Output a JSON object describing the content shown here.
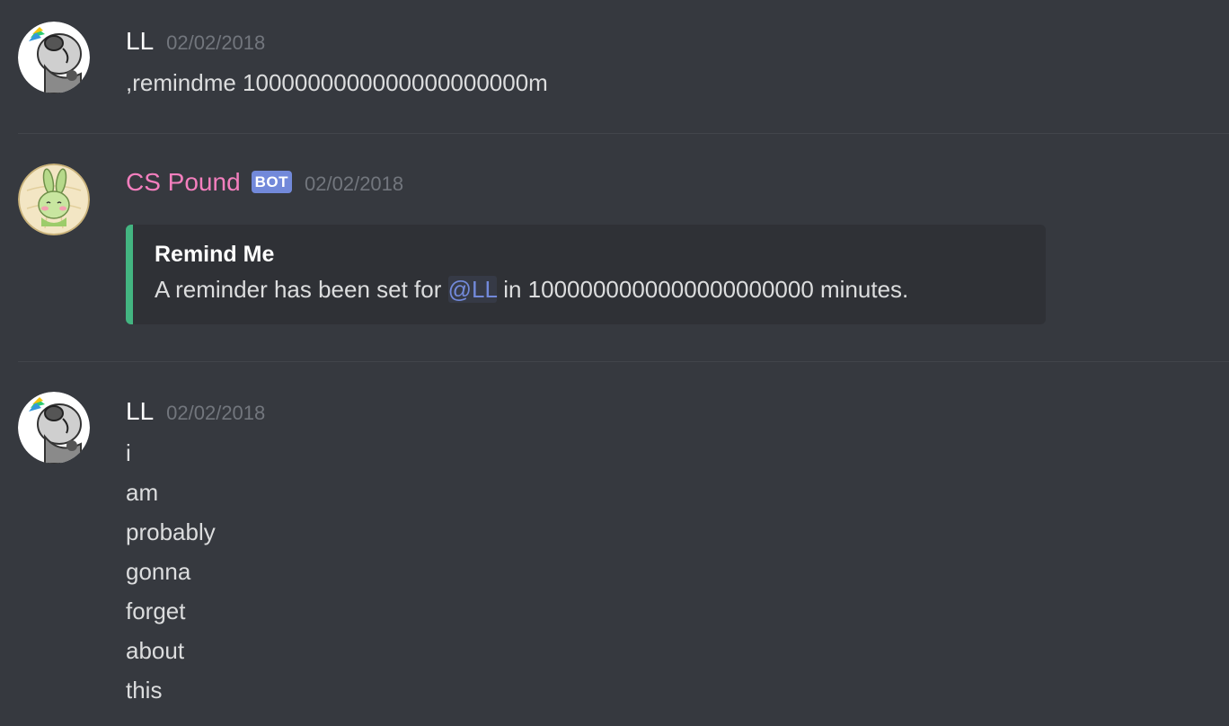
{
  "messages": [
    {
      "author": "LL",
      "timestamp": "02/02/2018",
      "lines": [
        ",remindme 1000000000000000000000m"
      ]
    },
    {
      "author": "CS Pound",
      "bot_tag": "BOT",
      "timestamp": "02/02/2018",
      "embed": {
        "title": "Remind Me",
        "desc_before": "A reminder has been set for ",
        "mention": "@LL",
        "desc_after": " in 1000000000000000000000 minutes.",
        "accent_color": "#43b581"
      }
    },
    {
      "author": "LL",
      "timestamp": "02/02/2018",
      "lines": [
        "i",
        "am",
        "probably",
        "gonna",
        "forget",
        "about",
        "this"
      ]
    }
  ],
  "colors": {
    "background": "#36393f",
    "bot_name": "#f47fbe",
    "bot_tag": "#7289da",
    "mention": "#7289da",
    "embed_bg": "#2f3136"
  },
  "icons": {
    "ll_avatar": "cartoon-animal-avatar-icon",
    "bot_avatar": "rabbit-avatar-icon"
  }
}
